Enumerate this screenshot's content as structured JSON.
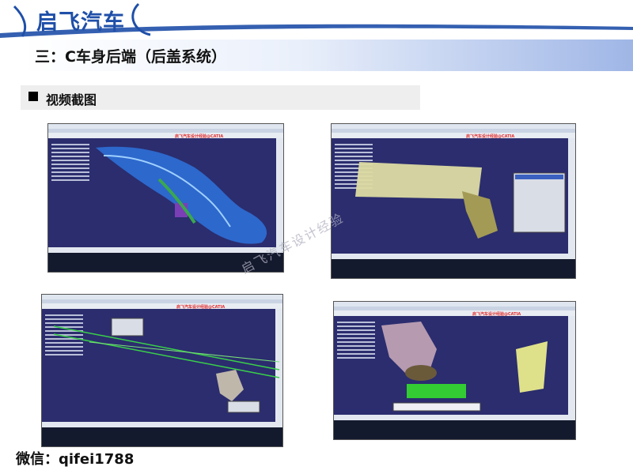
{
  "header": {
    "brand_title": "启飞汽车",
    "section_title": "三：C车身后端（后盖系统）",
    "subsection_title": "视频截图"
  },
  "footer": {
    "contact": "微信：qifei1788"
  },
  "watermark": {
    "text": "启飞汽车设计经验"
  },
  "screenshots": [
    {
      "caption_red": "启飞汽车设计经验@CATIA"
    },
    {
      "caption_red": "启飞汽车设计经验@CATIA"
    },
    {
      "caption_red": "启飞汽车设计经验@CATIA"
    },
    {
      "caption_red": "启飞汽车设计经验@CATIA"
    }
  ],
  "colors": {
    "brand_blue": "#1f4fa8",
    "banner_blue": "#9fb6e6",
    "cad_background": "#2b2d6e"
  }
}
